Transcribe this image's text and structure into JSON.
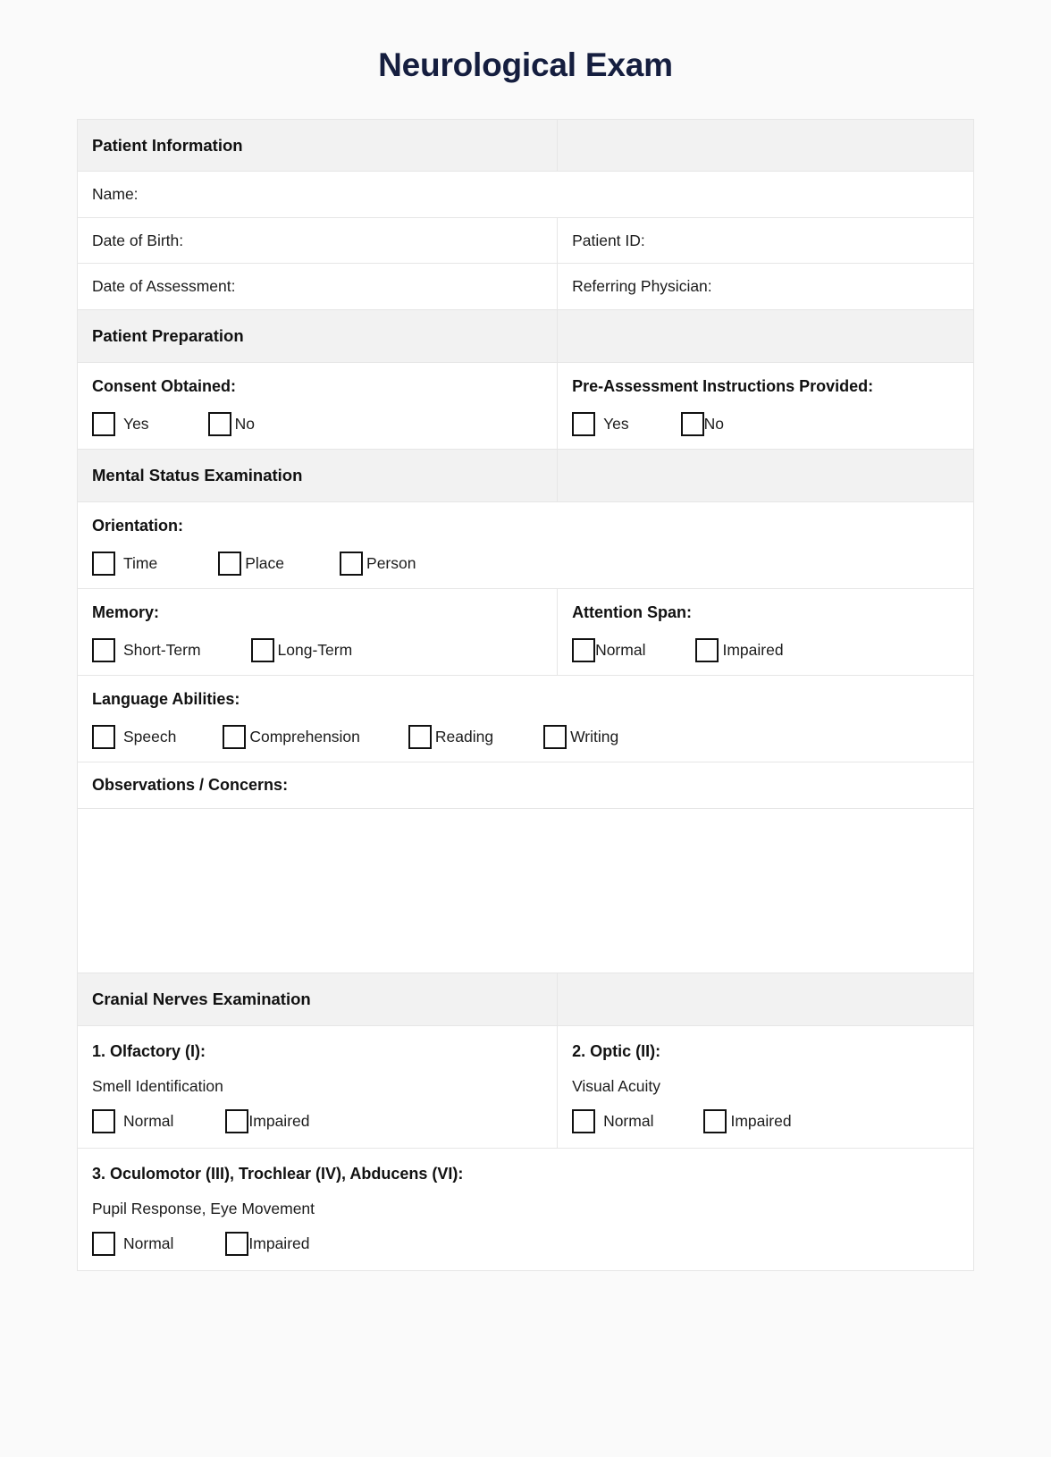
{
  "document": {
    "title": "Neurological Exam",
    "title_color": "#151e3f"
  },
  "sections": {
    "patient_information": {
      "heading": "Patient Information",
      "fields": {
        "name": "Name:",
        "date_of_birth": "Date of Birth:",
        "patient_id": "Patient ID:",
        "date_of_assessment": "Date of Assessment:",
        "referring_physician": "Referring Physician:"
      }
    },
    "patient_preparation": {
      "heading": "Patient Preparation",
      "consent": {
        "label": "Consent Obtained:",
        "options": [
          "Yes",
          "No"
        ]
      },
      "pre_assessment": {
        "label": "Pre-Assessment Instructions Provided:",
        "options": [
          "Yes",
          "No"
        ]
      }
    },
    "mental_status": {
      "heading": "Mental Status Examination",
      "orientation": {
        "label": "Orientation:",
        "options": [
          "Time",
          "Place",
          "Person"
        ]
      },
      "memory": {
        "label": "Memory:",
        "options": [
          "Short-Term",
          "Long-Term"
        ]
      },
      "attention_span": {
        "label": "Attention Span:",
        "options": [
          "Normal",
          "Impaired"
        ]
      },
      "language_abilities": {
        "label": "Language Abilities:",
        "options": [
          "Speech",
          "Comprehension",
          "Reading",
          "Writing"
        ]
      },
      "observations": {
        "label": "Observations / Concerns:",
        "value": ""
      }
    },
    "cranial_nerves": {
      "heading": "Cranial Nerves Examination",
      "olfactory": {
        "label": "1. Olfactory (I):",
        "test": "Smell Identification",
        "options": [
          "Normal",
          "Impaired"
        ]
      },
      "optic": {
        "label": "2. Optic (II):",
        "test": "Visual Acuity",
        "options": [
          "Normal",
          "Impaired"
        ]
      },
      "oculomotor": {
        "label": "3. Oculomotor (III), Trochlear (IV), Abducens (VI):",
        "test": "Pupil Response, Eye Movement",
        "options": [
          "Normal",
          "Impaired"
        ]
      }
    }
  }
}
